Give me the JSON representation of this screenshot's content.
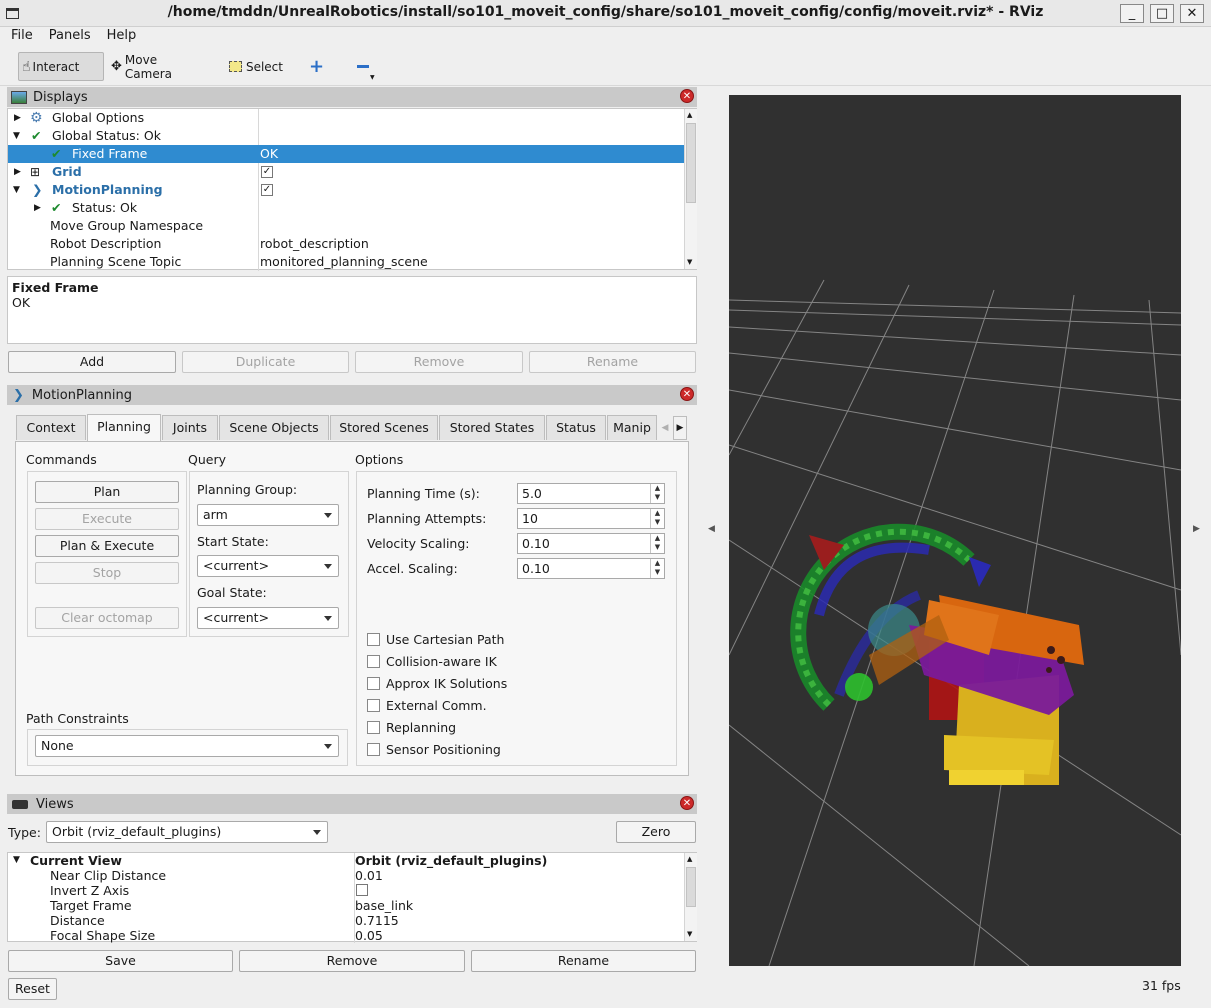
{
  "window": {
    "title": "/home/tmddn/UnrealRobotics/install/so101_moveit_config/share/so101_moveit_config/config/moveit.rviz* - RViz",
    "minimize": "_",
    "maximize": "□",
    "close": "✕"
  },
  "menu": [
    "File",
    "Panels",
    "Help"
  ],
  "toolbar": {
    "interact": "Interact",
    "move_camera": "Move Camera",
    "select": "Select"
  },
  "displays": {
    "title": "Displays",
    "rows": [
      {
        "name": "Global Options",
        "value": ""
      },
      {
        "name": "Global Status: Ok",
        "value": ""
      },
      {
        "name": "Fixed Frame",
        "value": "OK"
      },
      {
        "name": "Grid",
        "value": ""
      },
      {
        "name": "MotionPlanning",
        "value": ""
      },
      {
        "name": "Status: Ok",
        "value": ""
      },
      {
        "name": "Move Group Namespace",
        "value": ""
      },
      {
        "name": "Robot Description",
        "value": "robot_description"
      },
      {
        "name": "Planning Scene Topic",
        "value": "monitored_planning_scene"
      }
    ],
    "desc_title": "Fixed Frame",
    "desc_text": "OK",
    "buttons": [
      "Add",
      "Duplicate",
      "Remove",
      "Rename"
    ]
  },
  "motion": {
    "title": "MotionPlanning",
    "tabs": [
      "Context",
      "Planning",
      "Joints",
      "Scene Objects",
      "Stored Scenes",
      "Stored States",
      "Status",
      "Manip"
    ],
    "commands_label": "Commands",
    "query_label": "Query",
    "options_label": "Options",
    "cmd_buttons": [
      "Plan",
      "Execute",
      "Plan & Execute",
      "Stop",
      "Clear octomap"
    ],
    "planning_group_label": "Planning Group:",
    "planning_group": "arm",
    "start_state_label": "Start State:",
    "start_state": "<current>",
    "goal_state_label": "Goal State:",
    "goal_state": "<current>",
    "options": [
      {
        "label": "Planning Time (s):",
        "value": "5.0"
      },
      {
        "label": "Planning Attempts:",
        "value": "10"
      },
      {
        "label": "Velocity Scaling:",
        "value": "0.10"
      },
      {
        "label": "Accel. Scaling:",
        "value": "0.10"
      }
    ],
    "checkboxes": [
      "Use Cartesian Path",
      "Collision-aware IK",
      "Approx IK Solutions",
      "External Comm.",
      "Replanning",
      "Sensor Positioning"
    ],
    "path_constraints_label": "Path Constraints",
    "path_constraints": "None"
  },
  "views": {
    "title": "Views",
    "type_label": "Type:",
    "type_value": "Orbit (rviz_default_plugins)",
    "zero": "Zero",
    "rows": [
      {
        "name": "Current View",
        "value": "Orbit (rviz_default_plugins)"
      },
      {
        "name": "Near Clip Distance",
        "value": "0.01"
      },
      {
        "name": "Invert Z Axis",
        "value": ""
      },
      {
        "name": "Target Frame",
        "value": "base_link"
      },
      {
        "name": "Distance",
        "value": "0.7115"
      },
      {
        "name": "Focal Shape Size",
        "value": "0.05"
      }
    ],
    "buttons": [
      "Save",
      "Remove",
      "Rename"
    ]
  },
  "reset": "Reset",
  "fps": "31 fps"
}
